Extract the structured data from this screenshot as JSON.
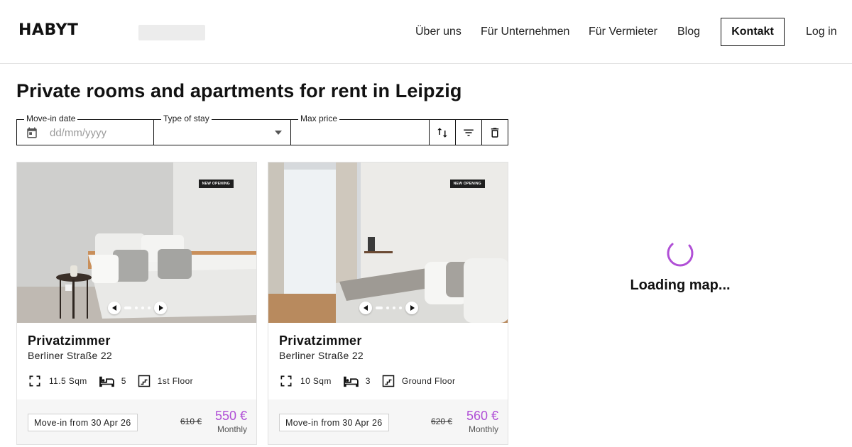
{
  "brand": {
    "logo_text": "HABYT",
    "accent": "#b04fd6"
  },
  "nav": {
    "links": [
      "Über uns",
      "Für Unternehmen",
      "Für Vermieter",
      "Blog"
    ],
    "contact_label": "Kontakt",
    "login_label": "Log in"
  },
  "page": {
    "title": "Private rooms and apartments for rent in Leipzig"
  },
  "filters": {
    "move_in": {
      "label": "Move-in date",
      "placeholder": "dd/mm/yyyy"
    },
    "stay": {
      "label": "Type of stay",
      "value": ""
    },
    "price": {
      "label": "Max price",
      "value": ""
    },
    "icons": [
      "sort-icon",
      "filter-icon",
      "trash-icon"
    ]
  },
  "listings": [
    {
      "badge": "NEW OPENING",
      "title": "Privatzimmer",
      "address": "Berliner Straße 22",
      "size": "11.5 Sqm",
      "beds": "5",
      "floor": "1st Floor",
      "move_in": "Move-in from 30 Apr 26",
      "old_price": "610 €",
      "price": "550 €",
      "period": "Monthly"
    },
    {
      "badge": "NEW OPENING",
      "title": "Privatzimmer",
      "address": "Berliner Straße 22",
      "size": "10 Sqm",
      "beds": "3",
      "floor": "Ground Floor",
      "move_in": "Move-in from 30 Apr 26",
      "old_price": "620 €",
      "price": "560 €",
      "period": "Monthly"
    }
  ],
  "map": {
    "loading_text": "Loading map..."
  }
}
